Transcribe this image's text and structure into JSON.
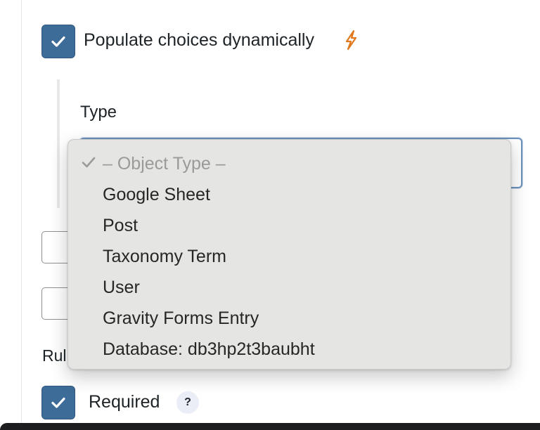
{
  "dynamic_option": {
    "label": "Populate choices dynamically",
    "checked": true,
    "accent_color": "#e0781e"
  },
  "type_field": {
    "label": "Type",
    "selected": "– Object Type –",
    "options": [
      "– Object Type –",
      "Google Sheet",
      "Post",
      "Taxonomy Term",
      "User",
      "Gravity Forms Entry",
      "Database: db3hp2t3baubht"
    ]
  },
  "rules": {
    "label_fragment": "Rul"
  },
  "required": {
    "label": "Required",
    "checked": true,
    "help_text": "?"
  },
  "colors": {
    "checkbox": "#3e6c98",
    "focus_border": "#6e92bc",
    "dropdown_bg": "#e5e5e3"
  },
  "icons": {
    "checkbox": "checkmark-icon",
    "bolt": "lightning-bolt-icon",
    "selected": "checkmark-icon"
  }
}
